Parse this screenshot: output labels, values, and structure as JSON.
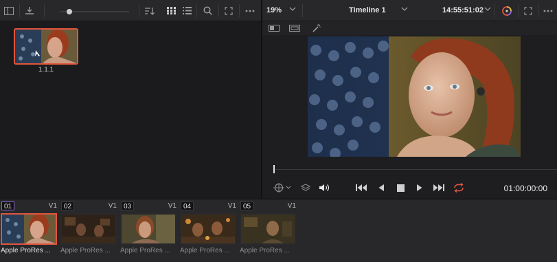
{
  "toolbar": {
    "zoom": "19%",
    "timeline_name": "Timeline 1",
    "timecode": "14:55:51:02"
  },
  "media_pool": {
    "clip_label": "1.1.1"
  },
  "viewer": {
    "playback_timecode": "01:00:00:00",
    "scrub_position": 0
  },
  "timeline_clips": [
    {
      "number": "01",
      "track": "V1",
      "name": "Apple ProRes ...",
      "active": true
    },
    {
      "number": "02",
      "track": "V1",
      "name": "Apple ProRes ...",
      "active": false
    },
    {
      "number": "03",
      "track": "V1",
      "name": "Apple ProRes ...",
      "active": false
    },
    {
      "number": "04",
      "track": "V1",
      "name": "Apple ProRes ...",
      "active": false
    },
    {
      "number": "05",
      "track": "V1",
      "name": "Apple ProRes ...",
      "active": false
    }
  ],
  "colors": {
    "accent_orange": "#e2553c",
    "accent_purple": "#8b6bd8",
    "panel": "#28282b",
    "background": "#1b1b1e"
  },
  "icons": [
    "panel-toggle-icon",
    "import-icon",
    "sort-icon",
    "grid-view-icon",
    "list-view-icon",
    "search-icon",
    "expand-icon",
    "more-icon",
    "chevron-down-icon",
    "color-wheel-icon",
    "fullscreen-icon",
    "viewer-mode-icon",
    "safe-area-icon",
    "magic-wand-icon",
    "target-icon",
    "layers-icon",
    "audio-icon",
    "skip-back-icon",
    "step-back-icon",
    "stop-icon",
    "play-icon",
    "skip-forward-icon",
    "loop-icon"
  ]
}
